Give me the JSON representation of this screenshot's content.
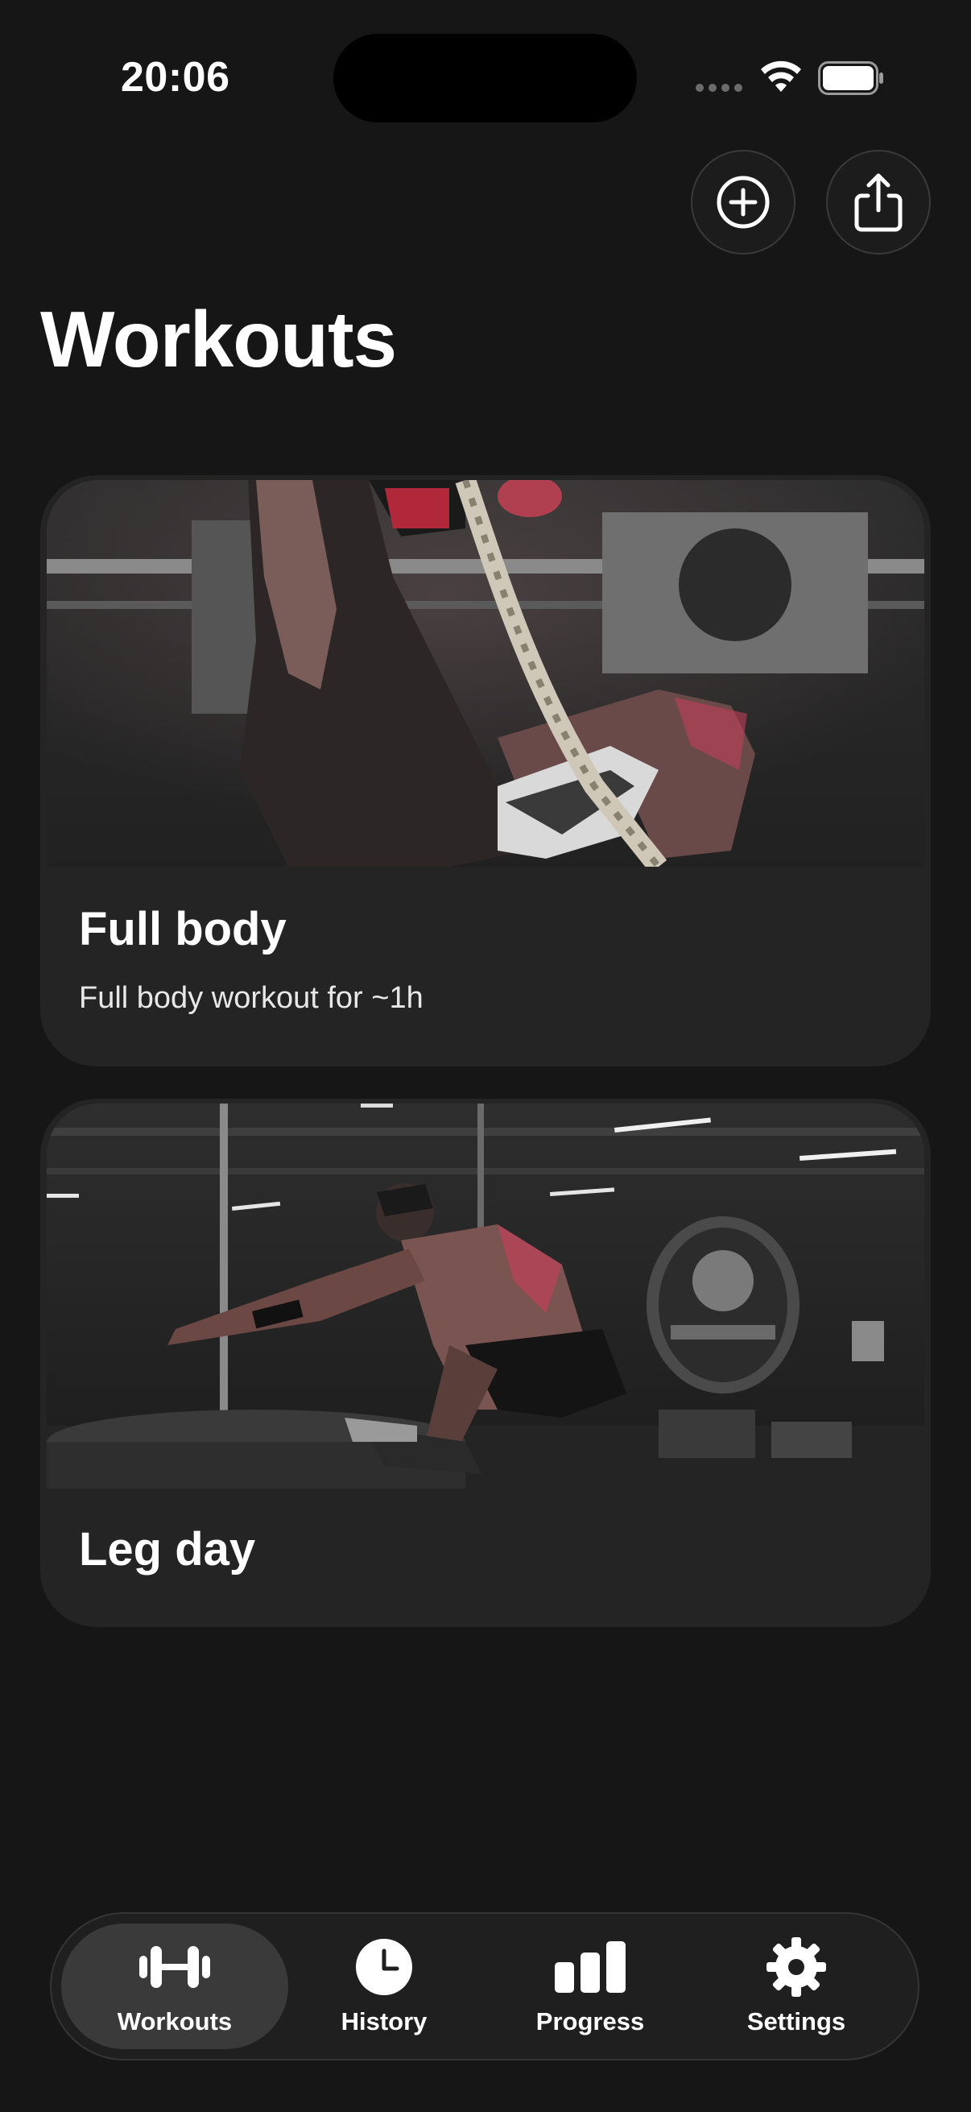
{
  "status_bar": {
    "time": "20:06"
  },
  "header": {
    "title": "Workouts",
    "add_icon": "plus-circle-icon",
    "share_icon": "share-icon"
  },
  "workouts": [
    {
      "title": "Full body",
      "description": "Full body workout for ~1h",
      "image": "athlete climbing rope in gym"
    },
    {
      "title": "Leg day",
      "image": "athlete box jumping in gym"
    }
  ],
  "tab_bar": {
    "items": [
      {
        "label": "Workouts",
        "icon": "dumbbell-icon",
        "active": true
      },
      {
        "label": "History",
        "icon": "clock-icon",
        "active": false
      },
      {
        "label": "Progress",
        "icon": "bar-chart-icon",
        "active": false
      },
      {
        "label": "Settings",
        "icon": "gear-icon",
        "active": false
      }
    ]
  },
  "colors": {
    "background": "#161616",
    "card": "#242424",
    "active_tab": "#3a3a3a",
    "accent_red": "#c23a4a"
  }
}
